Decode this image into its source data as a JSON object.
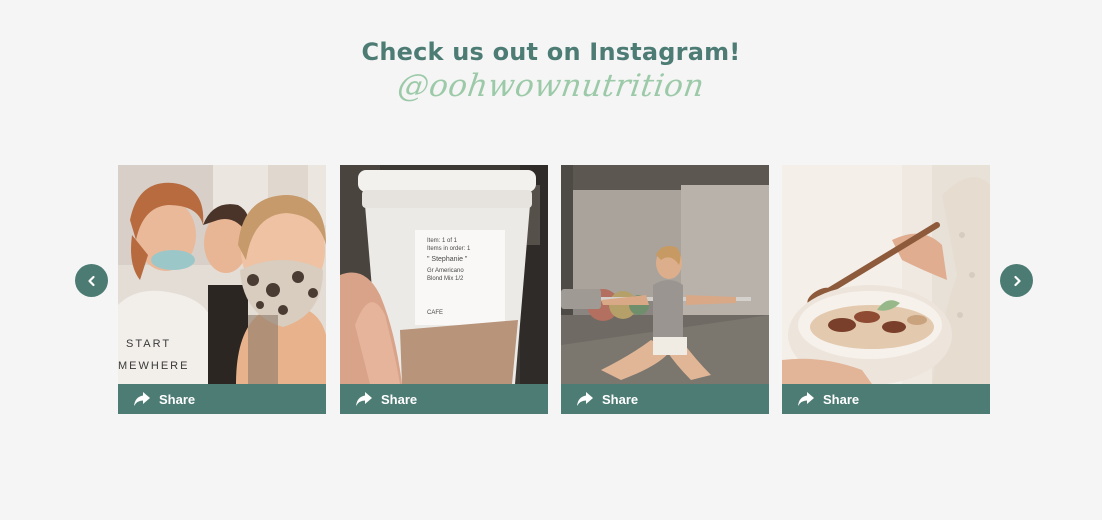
{
  "section": {
    "heading": "Check us out on Instagram!",
    "handle": "@oohwownutrition"
  },
  "carousel": {
    "prev_icon": "chevron-left-icon",
    "next_icon": "chevron-right-icon",
    "posts": [
      {
        "photo": "three-women-selfie-photo",
        "share_label": "Share",
        "share_icon": "share-arrow-icon"
      },
      {
        "photo": "coffee-cup-photo",
        "share_label": "Share",
        "share_icon": "share-arrow-icon",
        "cup_text": [
          "Item: 1 of 1",
          "Items in order: 1",
          "\" Stephanie \"",
          "Gr Americano",
          "Blond Mix 1/2",
          "CAFE"
        ]
      },
      {
        "photo": "barbell-squat-photo",
        "share_label": "Share",
        "share_icon": "share-arrow-icon"
      },
      {
        "photo": "food-bowl-photo",
        "share_label": "Share",
        "share_icon": "share-arrow-icon"
      }
    ]
  },
  "colors": {
    "brand_teal": "#4d7c75",
    "handle_green": "#9ccaa9",
    "background": "#f5f5f5"
  }
}
